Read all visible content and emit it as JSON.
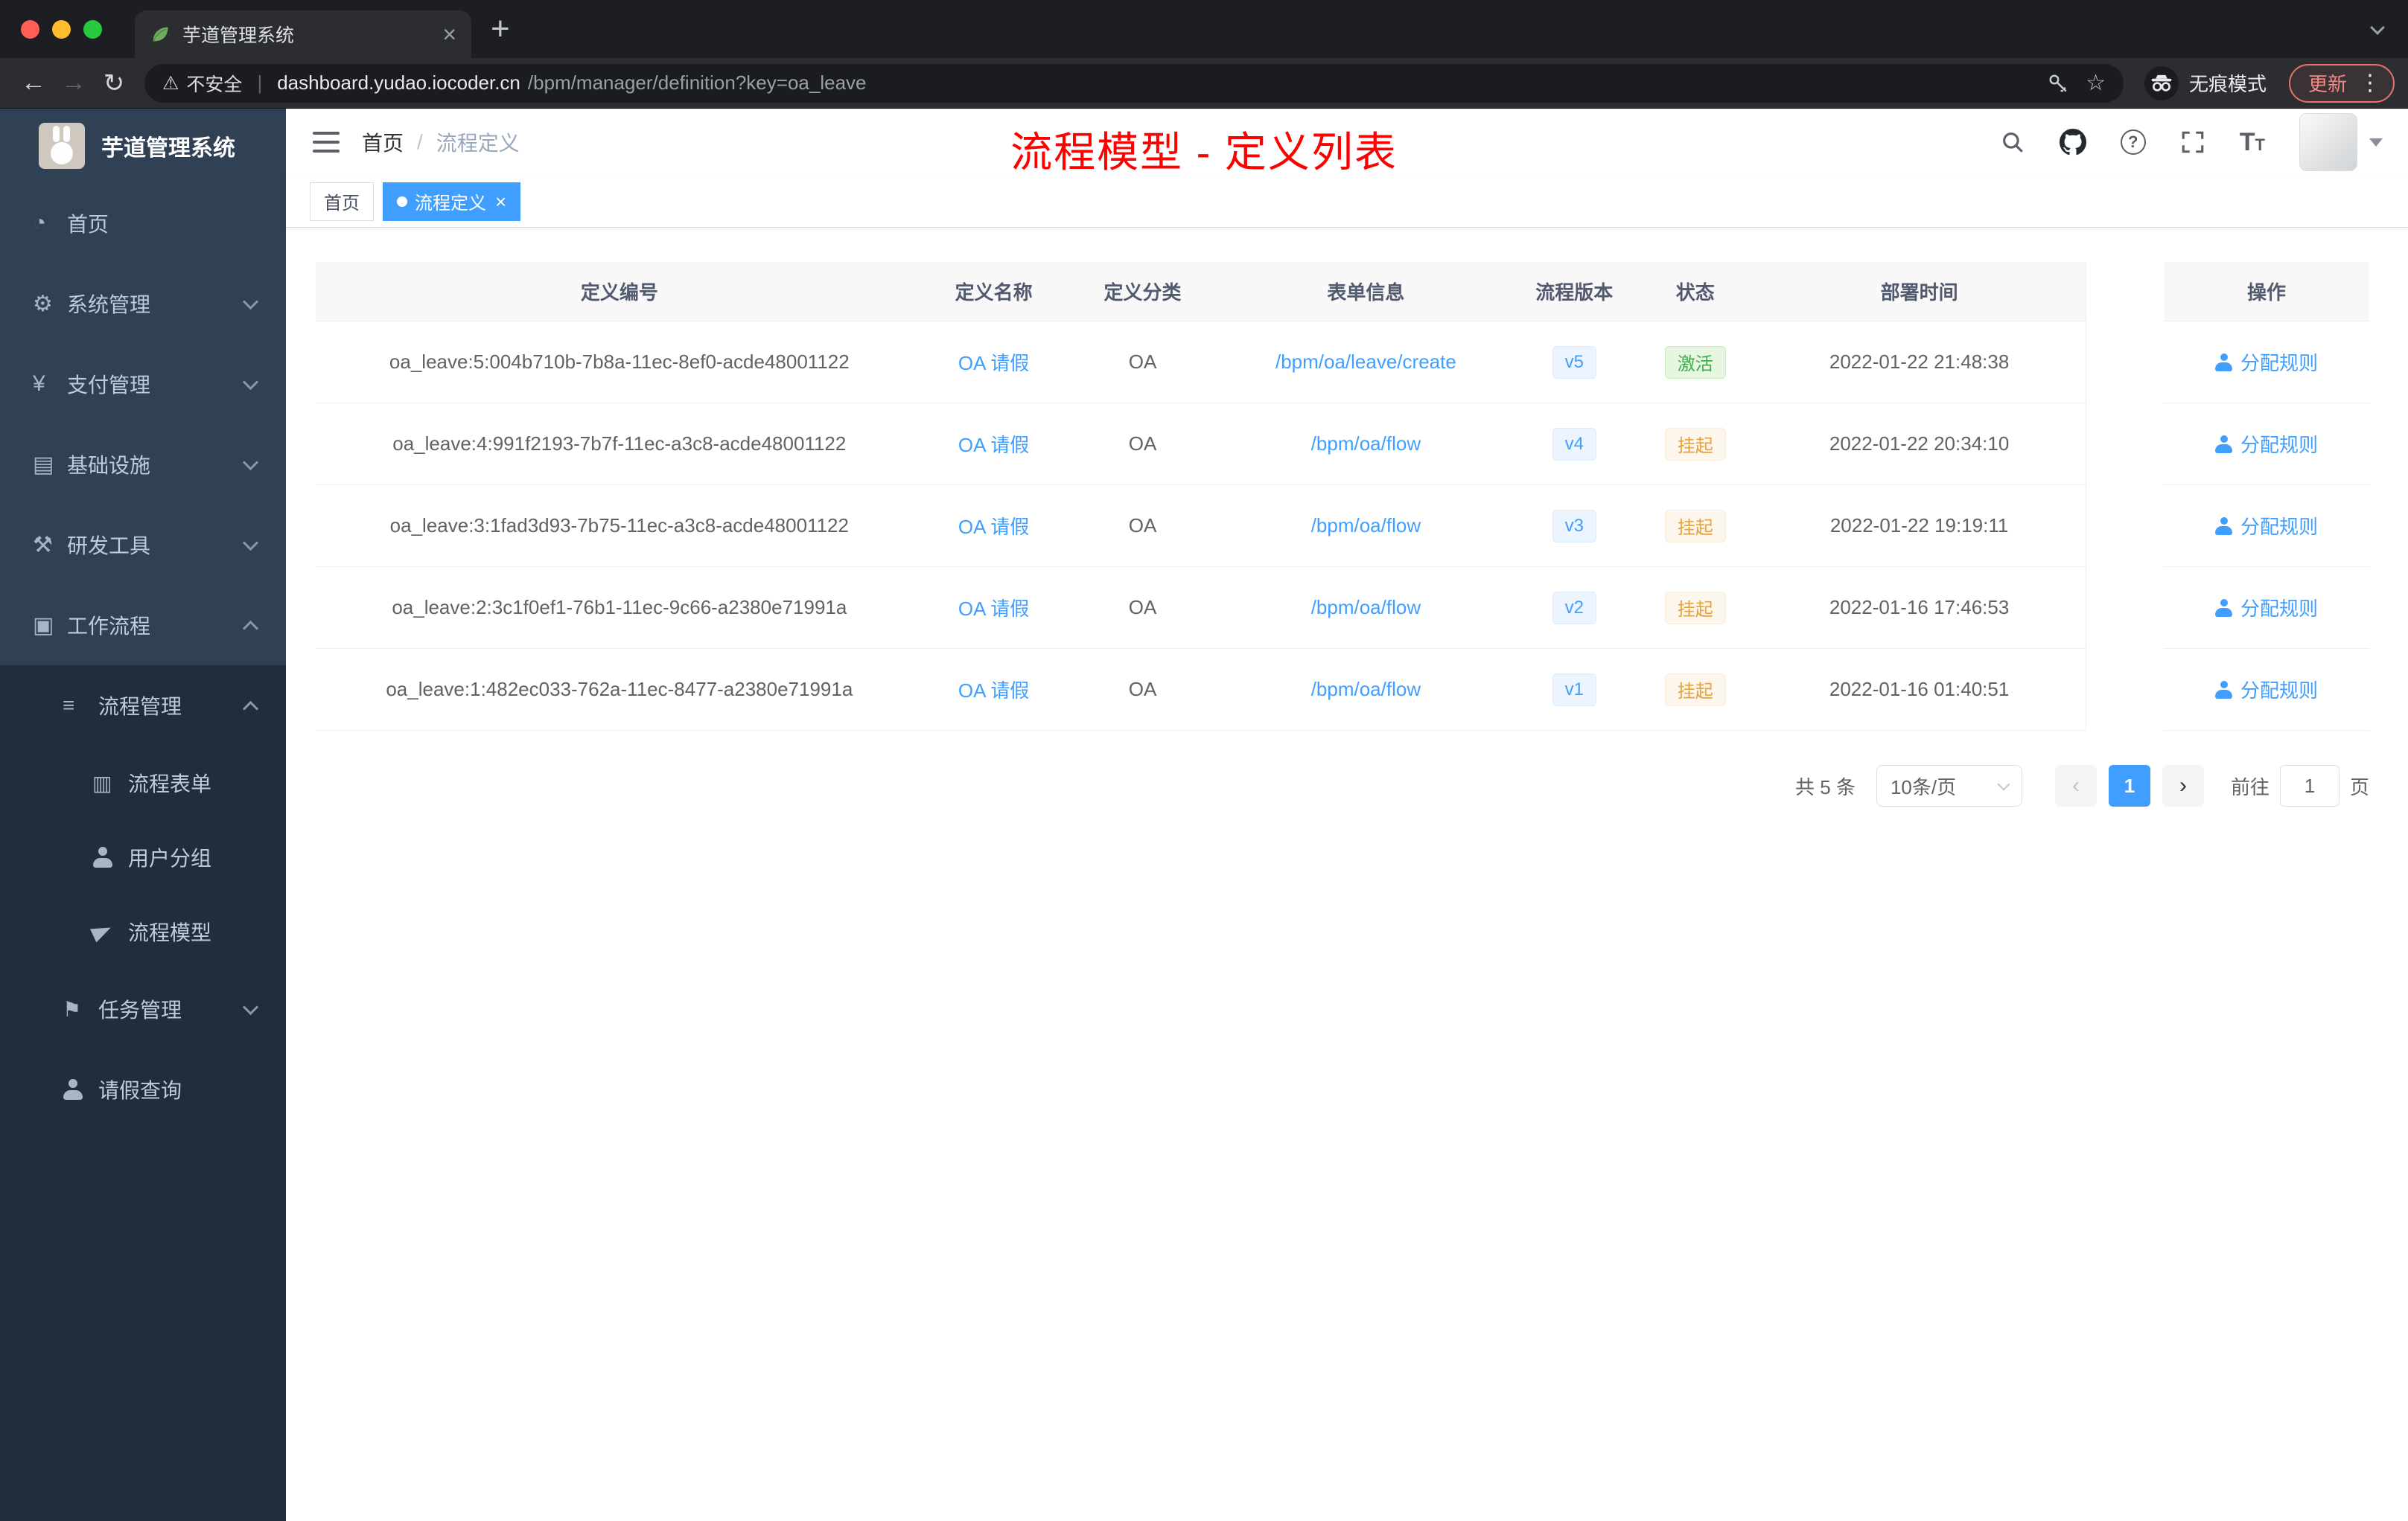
{
  "colors": {
    "accent_blue": "#409eff",
    "success_green": "#3daf48",
    "warning_orange": "#e6a23c",
    "annotation_red": "#ff0000",
    "sidebar_bg": "#304156",
    "sidebar_submenu_bg": "#1f2d3d",
    "table_header_bg": "#f8f8f9"
  },
  "browser": {
    "tab_title": "芋道管理系统",
    "security_label": "不安全",
    "url_domain": "dashboard.yudao.iocoder.cn",
    "url_path": "/bpm/manager/definition?key=oa_leave",
    "incognito_label": "无痕模式",
    "update_label": "更新"
  },
  "sidebar": {
    "logo_title": "芋道管理系统",
    "items": [
      {
        "key": "home",
        "label": "首页",
        "icon": "dashboard-icon",
        "level": 1,
        "section": "top"
      },
      {
        "key": "system-management",
        "label": "系统管理",
        "icon": "gear-icon",
        "level": 1,
        "chevron": "down",
        "section": "top"
      },
      {
        "key": "payment-management",
        "label": "支付管理",
        "icon": "yen-icon",
        "level": 1,
        "chevron": "down",
        "section": "top"
      },
      {
        "key": "infrastructure",
        "label": "基础设施",
        "icon": "infrastructure-icon",
        "level": 1,
        "chevron": "down",
        "section": "top"
      },
      {
        "key": "dev-tools",
        "label": "研发工具",
        "icon": "tools-icon",
        "level": 1,
        "chevron": "down",
        "section": "top"
      },
      {
        "key": "workflow",
        "label": "工作流程",
        "icon": "workflow-icon",
        "level": 1,
        "chevron": "up",
        "section": "top"
      },
      {
        "key": "process-management",
        "label": "流程管理",
        "icon": "list-icon",
        "level": 2,
        "chevron": "up",
        "section": "sub"
      },
      {
        "key": "process-form",
        "label": "流程表单",
        "icon": "form-icon",
        "level": 3,
        "section": "sub"
      },
      {
        "key": "user-group",
        "label": "用户分组",
        "icon": "users-icon",
        "level": 3,
        "section": "sub"
      },
      {
        "key": "process-model",
        "label": "流程模型",
        "icon": "send-icon",
        "level": 3,
        "section": "sub"
      },
      {
        "key": "task-management",
        "label": "任务管理",
        "icon": "task-icon",
        "level": 2,
        "chevron": "down",
        "section": "sub"
      },
      {
        "key": "leave-query",
        "label": "请假查询",
        "icon": "person-icon",
        "level": 2,
        "section": "sub"
      }
    ]
  },
  "header": {
    "breadcrumb": [
      "首页",
      "流程定义"
    ],
    "breadcrumb_separator": "/",
    "annotation": "流程模型 - 定义列表"
  },
  "tags": {
    "items": [
      {
        "key": "home",
        "label": "首页",
        "active": false,
        "closable": false
      },
      {
        "key": "process-definition",
        "label": "流程定义",
        "active": true,
        "closable": true
      }
    ]
  },
  "table": {
    "columns": [
      "定义编号",
      "定义名称",
      "定义分类",
      "表单信息",
      "流程版本",
      "状态",
      "部署时间",
      "操作"
    ],
    "rows": [
      {
        "id": "oa_leave:5:004b710b-7b8a-11ec-8ef0-acde48001122",
        "name": "OA 请假",
        "category": "OA",
        "form": "/bpm/oa/leave/create",
        "version": "v5",
        "status": "激活",
        "status_type": "success",
        "time": "2022-01-22 21:48:38",
        "action": "分配规则"
      },
      {
        "id": "oa_leave:4:991f2193-7b7f-11ec-a3c8-acde48001122",
        "name": "OA 请假",
        "category": "OA",
        "form": "/bpm/oa/flow",
        "version": "v4",
        "status": "挂起",
        "status_type": "warning",
        "time": "2022-01-22 20:34:10",
        "action": "分配规则"
      },
      {
        "id": "oa_leave:3:1fad3d93-7b75-11ec-a3c8-acde48001122",
        "name": "OA 请假",
        "category": "OA",
        "form": "/bpm/oa/flow",
        "version": "v3",
        "status": "挂起",
        "status_type": "warning",
        "time": "2022-01-22 19:19:11",
        "action": "分配规则"
      },
      {
        "id": "oa_leave:2:3c1f0ef1-76b1-11ec-9c66-a2380e71991a",
        "name": "OA 请假",
        "category": "OA",
        "form": "/bpm/oa/flow",
        "version": "v2",
        "status": "挂起",
        "status_type": "warning",
        "time": "2022-01-16 17:46:53",
        "action": "分配规则"
      },
      {
        "id": "oa_leave:1:482ec033-762a-11ec-8477-a2380e71991a",
        "name": "OA 请假",
        "category": "OA",
        "form": "/bpm/oa/flow",
        "version": "v1",
        "status": "挂起",
        "status_type": "warning",
        "time": "2022-01-16 01:40:51",
        "action": "分配规则"
      }
    ]
  },
  "pagination": {
    "total": "共 5 条",
    "page_size": "10条/页",
    "current_page": "1",
    "goto_prefix": "前往",
    "goto_value": "1",
    "goto_suffix": "页"
  }
}
